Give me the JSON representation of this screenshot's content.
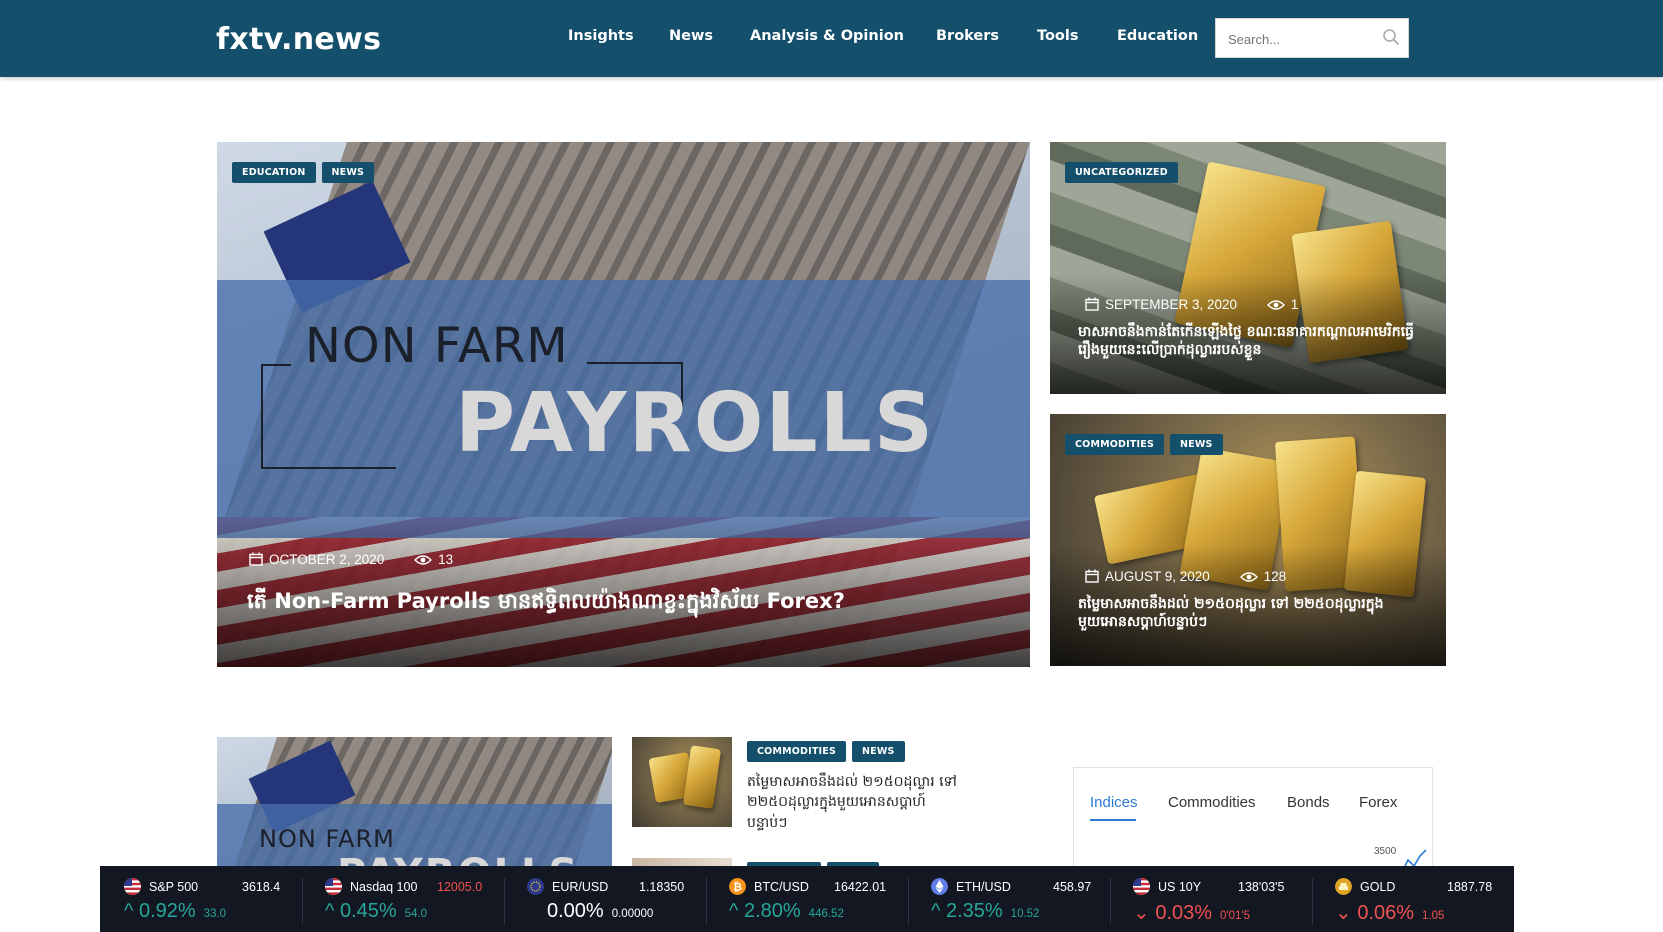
{
  "header": {
    "logo": "fxtv.news",
    "nav": [
      "Insights",
      "News",
      "Analysis & Opinion",
      "Brokers",
      "Tools",
      "Education"
    ],
    "search_placeholder": "Search..."
  },
  "hero_main": {
    "tags": [
      "EDUCATION",
      "NEWS"
    ],
    "image_text_1": "NON FARM",
    "image_text_2": "PAYROLLS",
    "date": "OCTOBER 2, 2020",
    "views": "13",
    "title": "តើ Non-Farm Payrolls មានឥទ្ធិពលយ៉ាងណាខ្លះក្នុងវិស័យ Forex?"
  },
  "hero_top": {
    "tags": [
      "UNCATEGORIZED"
    ],
    "date": "SEPTEMBER 3, 2020",
    "views": "1",
    "title": "មាសអាចនឹងកាន់តែកើនឡើងថ្លៃ ខណៈធនាគារកណ្ដាលអាមេរិកធ្វើរឿងមួយនេះលើប្រាក់ដុល្លាររបស់ខ្លួន"
  },
  "hero_bot": {
    "tags": [
      "COMMODITIES",
      "NEWS"
    ],
    "date": "AUGUST 9, 2020",
    "views": "128",
    "title": "តម្លៃមាសអាចនឹងដល់ ២១៥០ដុល្លារ ទៅ ២២៥០ដុល្លារក្នុងមួយអោនសប្ដាហ៍បន្ទាប់ៗ"
  },
  "second_row": {
    "large_image_text_1": "NON FARM",
    "large_image_text_2": "PAYROLLS",
    "list_item": {
      "tags": [
        "COMMODITIES",
        "NEWS"
      ],
      "title": "តម្លៃមាសអាចនឹងដល់ ២១៥០ដុល្លារ ទៅ ២២៥០ដុល្លារក្នុងមួយអោនសប្ដាហ៍បន្ទាប់ៗ"
    }
  },
  "widget": {
    "tabs": [
      "Indices",
      "Commodities",
      "Bonds",
      "Forex"
    ],
    "active_tab": "Indices",
    "axis_label": "3500"
  },
  "ticker": [
    {
      "name": "S&P 500",
      "price": "3618.4",
      "change": "0.92%",
      "delta": "33.0",
      "direction": "up",
      "flag": "us-flag-icon"
    },
    {
      "name": "Nasdaq 100",
      "price": "12005.0",
      "change": "0.45%",
      "delta": "54.0",
      "direction": "up",
      "flag": "us-flag-icon"
    },
    {
      "name": "EUR/USD",
      "price": "1.18350",
      "change": "0.00%",
      "delta": "0.00000",
      "direction": "flat",
      "flag": "eu-flag-icon"
    },
    {
      "name": "BTC/USD",
      "price": "16422.01",
      "change": "2.80%",
      "delta": "446.52",
      "direction": "up",
      "flag": "bitcoin-icon"
    },
    {
      "name": "ETH/USD",
      "price": "458.97",
      "change": "2.35%",
      "delta": "10.52",
      "direction": "up",
      "flag": "ethereum-icon"
    },
    {
      "name": "US 10Y",
      "price": "138'03'5",
      "change": "0.03%",
      "delta": "0'01'5",
      "direction": "down",
      "flag": "us-flag-icon"
    },
    {
      "name": "GOLD",
      "price": "1887.78",
      "change": "0.06%",
      "delta": "1.05",
      "direction": "down",
      "flag": "gold-icon"
    }
  ],
  "colors": {
    "brand": "#144f6c",
    "ticker_bg": "#131722",
    "up": "#26a69a",
    "down": "#ef5350",
    "tab_active": "#2a7bd6"
  }
}
